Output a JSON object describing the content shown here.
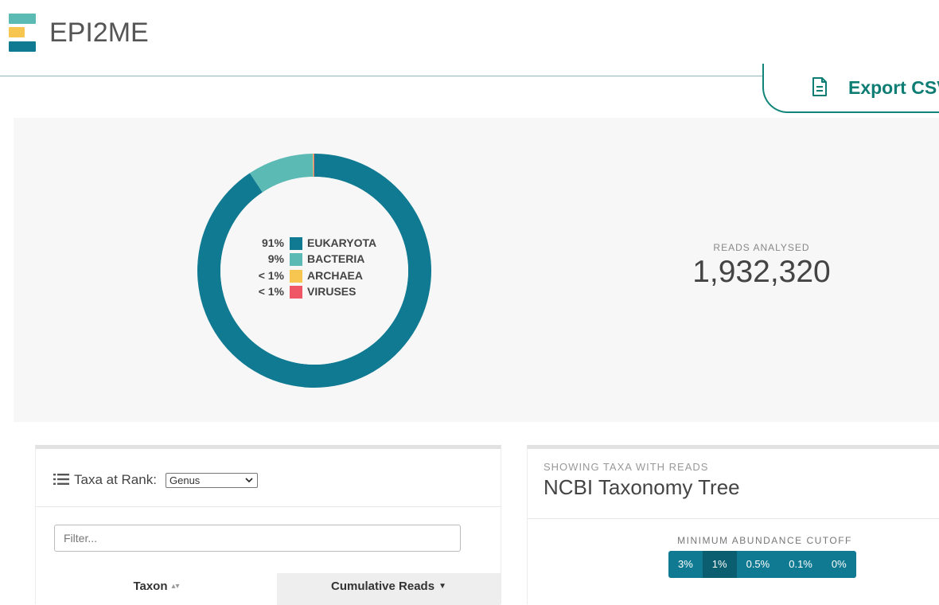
{
  "header": {
    "brand": "EPI2ME",
    "export_label": "Export CSV"
  },
  "summary": {
    "reads_label": "READS ANALYSED",
    "reads_value": "1,932,320",
    "legend": [
      {
        "pct": "91%",
        "name": "EUKARYOTA",
        "color": "#107a92"
      },
      {
        "pct": "9%",
        "name": "BACTERIA",
        "color": "#5bbab4"
      },
      {
        "pct": "< 1%",
        "name": "ARCHAEA",
        "color": "#f6c651"
      },
      {
        "pct": "< 1%",
        "name": "VIRUSES",
        "color": "#ef5766"
      }
    ]
  },
  "chart_data": {
    "type": "pie",
    "categories": [
      "EUKARYOTA",
      "BACTERIA",
      "ARCHAEA",
      "VIRUSES"
    ],
    "values": [
      90.7,
      9.1,
      0.1,
      0.1
    ],
    "labels": [
      "91%",
      "9%",
      "< 1%",
      "< 1%"
    ],
    "colors": [
      "#107a92",
      "#5bbab4",
      "#f6c651",
      "#ef5766"
    ],
    "donut": true
  },
  "taxa": {
    "title": "Taxa at Rank:",
    "rank_selected": "Genus",
    "filter_placeholder": "Filter...",
    "col_taxon": "Taxon",
    "col_reads": "Cumulative Reads"
  },
  "tree": {
    "subtitle": "SHOWING TAXA WITH READS",
    "title": "NCBI Taxonomy Tree",
    "cutoff_label": "MINIMUM ABUNDANCE CUTOFF",
    "cutoffs": [
      "3%",
      "1%",
      "0.5%",
      "0.1%",
      "0%"
    ],
    "active_cutoff": "1%"
  }
}
